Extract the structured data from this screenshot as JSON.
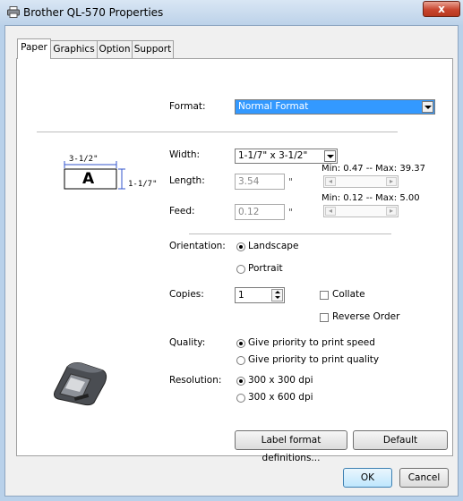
{
  "window": {
    "title": "Brother QL-570 Properties",
    "close_glyph": "x"
  },
  "tabs": [
    {
      "label": "Paper",
      "active": true
    },
    {
      "label": "Graphics",
      "active": false
    },
    {
      "label": "Option",
      "active": false
    },
    {
      "label": "Support",
      "active": false
    }
  ],
  "paper": {
    "format_label": "Format:",
    "format_value": "Normal Format",
    "width_label": "Width:",
    "width_value": "1-1/7\" x 3-1/2\"",
    "length_label": "Length:",
    "length_value": "3.54",
    "length_unit": "\"",
    "length_range": "Min: 0.47 -- Max: 39.37",
    "feed_label": "Feed:",
    "feed_value": "0.12",
    "feed_unit": "\"",
    "feed_range": "Min: 0.12 -- Max: 5.00",
    "label_preview": {
      "width_text": "3-1/2\"",
      "height_text": "1-1/7\"",
      "letter": "A"
    },
    "orientation_label": "Orientation:",
    "orientation_options": [
      "Landscape",
      "Portrait"
    ],
    "orientation_selected": "Landscape",
    "copies_label": "Copies:",
    "copies_value": "1",
    "collate_label": "Collate",
    "reverse_order_label": "Reverse Order",
    "quality_label": "Quality:",
    "quality_options": [
      "Give priority to print speed",
      "Give priority to print quality"
    ],
    "quality_selected": "Give priority to print speed",
    "resolution_label": "Resolution:",
    "resolution_options": [
      "300 x 300 dpi",
      "300 x 600 dpi"
    ],
    "resolution_selected": "300 x 300 dpi",
    "label_format_button": "Label format definitions...",
    "default_button": "Default"
  },
  "footer": {
    "ok_label": "OK",
    "cancel_label": "Cancel"
  },
  "colors": {
    "titlebar": "#bcd2e9",
    "close": "#c8452f",
    "selection": "#3399ff"
  }
}
